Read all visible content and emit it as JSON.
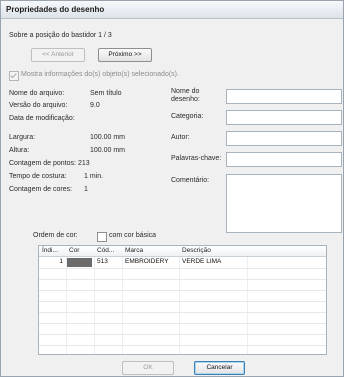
{
  "window": {
    "title": "Propriedades do desenho"
  },
  "nav": {
    "position_text": "Sobre a posição do bastidor 1 / 3",
    "prev_label": "<< Anterior",
    "next_label": "Próximo >>",
    "show_selected_label": "Mostra informações do(s) objeto(s) selecionado(s)."
  },
  "info": {
    "file_name_label": "Nome do arquivo:",
    "file_name_value": "Sem título",
    "file_version_label": "Versão do arquivo:",
    "file_version_value": "9.0",
    "modified_label": "Data de modificação:",
    "modified_value": "",
    "width_label": "Largura:",
    "width_value": "100.00 mm",
    "height_label": "Altura:",
    "height_value": "100.00 mm",
    "stitch_count_label": "Contagem de pontos:",
    "stitch_count_value": "213",
    "sew_time_label": "Tempo de costura:",
    "sew_time_value": "1 min.",
    "color_count_label": "Contagem de cores:",
    "color_count_value": "1"
  },
  "fields": {
    "design_name_label_1": "Nome do",
    "design_name_label_2": "desenho:",
    "design_name_value": "",
    "category_label": "Categoria:",
    "category_value": "",
    "author_label": "Autor:",
    "author_value": "",
    "keywords_label": "Palavras-chave:",
    "keywords_value": "",
    "comment_label": "Comentário:",
    "comment_value": ""
  },
  "colors": {
    "order_label": "Ordem de cor:",
    "basic_color_label": "com cor básica",
    "columns": [
      "Índi...",
      "Cor",
      "Cód...",
      "Marca",
      "Descrição"
    ],
    "rows": [
      {
        "index": "1",
        "color": "#6b6b6b",
        "code": "513",
        "brand": "EMBROIDERY",
        "description": "VERDE LIMA"
      }
    ]
  },
  "footer": {
    "ok_label": "OK",
    "cancel_label": "Cancelar"
  }
}
